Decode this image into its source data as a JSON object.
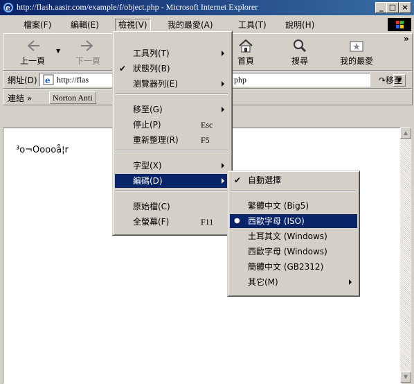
{
  "window": {
    "title": "http://flash.aasir.com/example/f/object.php - Microsoft Internet Explorer",
    "minimize": "_",
    "maximize": "□",
    "close": "×"
  },
  "menubar": [
    "檔案(F)",
    "編輯(E)",
    "檢視(V)",
    "我的最愛(A)",
    "工具(T)",
    "說明(H)"
  ],
  "toolbar": {
    "back": "上一頁",
    "forward": "下一頁",
    "home": "首頁",
    "search": "搜尋",
    "favorites": "我的最愛",
    "more": "»"
  },
  "address": {
    "label": "網址(D)",
    "value_left": "http://flas",
    "value_right": "php",
    "go": "移至"
  },
  "links": {
    "label": "連結 »",
    "item": "Norton Anti"
  },
  "page": {
    "text": "³o¬Ooooå¦r"
  },
  "view_menu": {
    "items": [
      {
        "label": "工具列(T)",
        "check": "",
        "shortcut": ""
      },
      {
        "label": "狀態列(B)",
        "check": "✔",
        "shortcut": ""
      },
      {
        "label": "瀏覽器列(E)",
        "check": "",
        "shortcut": ""
      },
      {
        "label": "移至(G)",
        "check": "",
        "shortcut": ""
      },
      {
        "label": "停止(P)",
        "check": "",
        "shortcut": "Esc"
      },
      {
        "label": "重新整理(R)",
        "check": "",
        "shortcut": "F5"
      },
      {
        "label": "字型(X)",
        "check": "",
        "shortcut": ""
      },
      {
        "label": "編碼(D)",
        "check": "",
        "shortcut": ""
      },
      {
        "label": "原始檔(C)",
        "check": "",
        "shortcut": ""
      },
      {
        "label": "全螢幕(F)",
        "check": "",
        "shortcut": "F11"
      }
    ]
  },
  "encoding_menu": {
    "items": [
      {
        "label": "自動選擇",
        "check": "✔"
      },
      {
        "label": "繁體中文 (Big5)",
        "check": ""
      },
      {
        "label": "西歐字母 (ISO)",
        "check": "●"
      },
      {
        "label": "土耳其文 (Windows)",
        "check": ""
      },
      {
        "label": "西歐字母 (Windows)",
        "check": ""
      },
      {
        "label": "簡體中文 (GB2312)",
        "check": ""
      },
      {
        "label": "其它(M)",
        "check": ""
      }
    ]
  },
  "colors": {
    "title_active": "#0a246a",
    "menu_highlight": "#0a246a",
    "chrome": "#d4d0c8"
  }
}
